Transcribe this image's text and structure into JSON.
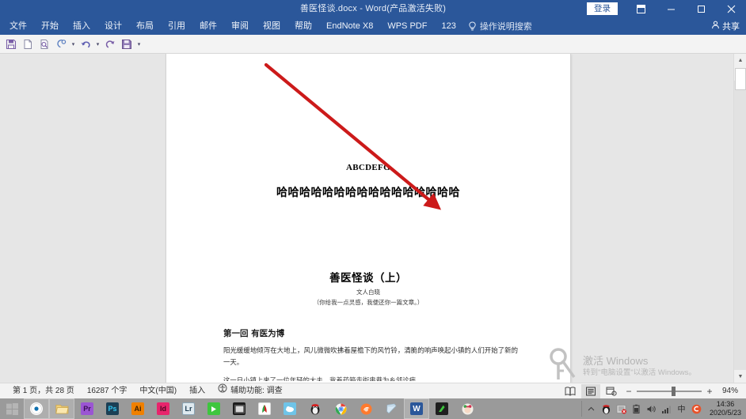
{
  "titlebar": {
    "document_title": "善医怪谈.docx  -  Word(产品激活失败)",
    "signin_label": "登录",
    "ribbon_display_icon": "ribbon-display-options-icon",
    "minimize_icon": "minimize-icon",
    "maximize_icon": "maximize-icon",
    "close_icon": "close-icon"
  },
  "menubar": {
    "items": [
      {
        "label": "文件"
      },
      {
        "label": "开始"
      },
      {
        "label": "插入"
      },
      {
        "label": "设计"
      },
      {
        "label": "布局"
      },
      {
        "label": "引用"
      },
      {
        "label": "邮件"
      },
      {
        "label": "审阅"
      },
      {
        "label": "视图"
      },
      {
        "label": "帮助"
      },
      {
        "label": "EndNote X8"
      },
      {
        "label": "WPS PDF"
      },
      {
        "label": "123"
      }
    ],
    "tell_me": "操作说明搜索",
    "share_label": "共享"
  },
  "quick_access": {
    "buttons": [
      {
        "name": "save-icon"
      },
      {
        "name": "new-document-icon"
      },
      {
        "name": "print-preview-icon"
      },
      {
        "name": "format-painter-icon"
      },
      {
        "name": "undo-icon"
      },
      {
        "name": "redo-icon"
      },
      {
        "name": "save-as-icon"
      },
      {
        "name": "customize-qat-icon"
      }
    ]
  },
  "document": {
    "line_abcdefg": "ABCDEFG",
    "line_haha": "哈哈哈哈哈哈哈哈哈哈哈哈哈哈哈哈",
    "title": "善医怪谈（上）",
    "author": "文人白晓",
    "subtitle": "（你给我一点灵感，我便还你一篇文章。）",
    "heading": "第一回  有医为博",
    "paragraph": "阳光缓缓地倾泻在大地上，风儿微微吹拂着屋檐下的风竹铃，清脆的响声唤起小镇的人们开始了新的一天。",
    "paragraph_partial": "这一日小镇上来了一位年轻的大夫，背着药箱走街串巷为乡邻诊病。"
  },
  "annotation": {
    "arrow_color": "#cc1a1a",
    "arrow_name": "red-annotation-arrow"
  },
  "watermark": {
    "line1": "激活 Windows",
    "line2": "转到\"电脑设置\"以激活 Windows。"
  },
  "statusbar": {
    "page_info": "第 1 页，共 28 页",
    "word_count": "16287 个字",
    "language": "中文(中国)",
    "insert_mode": "插入",
    "accessibility": "辅助功能: 调查",
    "views": [
      {
        "name": "read-mode-view-icon",
        "active": false
      },
      {
        "name": "print-layout-view-icon",
        "active": true
      },
      {
        "name": "web-layout-view-icon",
        "active": false
      }
    ],
    "zoom_out": "−",
    "zoom_in": "+",
    "zoom_level": "94%"
  },
  "taskbar": {
    "start_icon": "start-windows-icon",
    "items": [
      {
        "name": "cortana-search-icon",
        "label": "",
        "color": "#ffffff",
        "text_color": "#0078d7",
        "pinned": true
      },
      {
        "name": "file-explorer-icon",
        "label": "",
        "color": "#f5d27a",
        "text_color": "#7a5a10",
        "pinned": true
      },
      {
        "name": "adobe-premiere-icon",
        "label": "Pr",
        "color": "#9b55d3",
        "text_color": "#2a0a3d",
        "pinned": false
      },
      {
        "name": "adobe-photoshop-icon",
        "label": "Ps",
        "color": "#1b3f55",
        "text_color": "#31c5f0",
        "pinned": false
      },
      {
        "name": "adobe-illustrator-icon",
        "label": "Ai",
        "color": "#f08000",
        "text_color": "#3a1d00",
        "pinned": false
      },
      {
        "name": "adobe-indesign-icon",
        "label": "Id",
        "color": "#e8246c",
        "text_color": "#4a0520",
        "pinned": false
      },
      {
        "name": "adobe-lightroom-icon",
        "label": "Lr",
        "color": "#dfe9ef",
        "text_color": "#1e3d52",
        "pinned": false
      },
      {
        "name": "green-app-icon",
        "label": "",
        "color": "#3ec63e",
        "text_color": "#ffffff",
        "pinned": false
      },
      {
        "name": "video-editor-icon",
        "label": "",
        "color": "#1c1c1c",
        "text_color": "#dddddd",
        "pinned": false
      },
      {
        "name": "pdf-reader-icon",
        "label": "",
        "color": "#ffffff",
        "text_color": "#d02020",
        "pinned": false
      },
      {
        "name": "cloud-app-icon",
        "label": "",
        "color": "#6fc4e8",
        "text_color": "#ffffff",
        "pinned": false
      },
      {
        "name": "qq-messenger-icon",
        "label": "",
        "color": "#2b2b2b",
        "text_color": "#ffffff",
        "pinned": false
      },
      {
        "name": "google-chrome-icon",
        "label": "",
        "color": "#ffffff",
        "text_color": "#1a73e8",
        "pinned": false
      },
      {
        "name": "browser-app-icon",
        "label": "",
        "color": "#ff7a2e",
        "text_color": "#ffffff",
        "pinned": false
      },
      {
        "name": "notepad-icon",
        "label": "",
        "color": "#cfe3f2",
        "text_color": "#456",
        "pinned": false
      },
      {
        "name": "microsoft-word-icon",
        "label": "W",
        "color": "#2b579a",
        "text_color": "#ffffff",
        "pinned": false,
        "active": true
      },
      {
        "name": "green-folder-icon",
        "label": "",
        "color": "#1f1f1f",
        "text_color": "#3ec63e",
        "pinned": false
      },
      {
        "name": "avatar-app-icon",
        "label": "",
        "color": "#e8e8e8",
        "text_color": "#d03050",
        "pinned": false
      }
    ],
    "tray": {
      "show_hidden_icon": "show-hidden-icons-chevron",
      "icons": [
        {
          "name": "qq-tray-icon"
        },
        {
          "name": "security-shield-tray-icon"
        },
        {
          "name": "battery-tray-icon"
        },
        {
          "name": "volume-tray-icon"
        },
        {
          "name": "network-signal-tray-icon"
        },
        {
          "name": "ime-chinese-tray-icon"
        },
        {
          "name": "sogou-input-tray-icon"
        }
      ],
      "time": "14:36",
      "date": "2020/5/23"
    }
  }
}
